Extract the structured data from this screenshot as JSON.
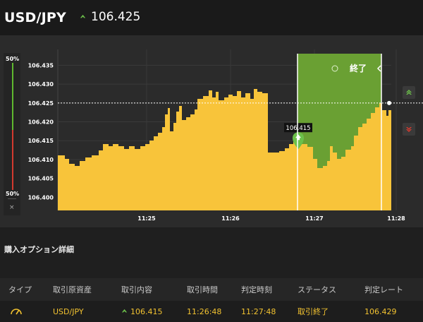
{
  "header": {
    "pair": "USD/JPY",
    "rate": "106.425",
    "rate_direction": "up"
  },
  "gauge": {
    "top_label": "50%",
    "bottom_label": "50%",
    "close_label": "×"
  },
  "chart_data": {
    "type": "area",
    "y_ticks": [
      "106.435",
      "106.430",
      "106.425",
      "106.420",
      "106.415",
      "106.410",
      "106.405",
      "106.400"
    ],
    "x_ticks": [
      "11:25",
      "11:26",
      "11:27",
      "11:28"
    ],
    "current_rate": 106.425,
    "entry_rate": 106.415,
    "entry_label": "106.415",
    "window_label": "終了",
    "colors": {
      "area": "#f8c43a",
      "window": "#6aa033",
      "grid": "#3a3a3a",
      "up": "#6cc04a",
      "down": "#d83a2e"
    }
  },
  "section": {
    "title": "購入オプション詳細"
  },
  "table": {
    "headers": [
      "タイプ",
      "取引原資産",
      "取引内容",
      "取引時間",
      "判定時刻",
      "ステータス",
      "判定レート"
    ],
    "row": {
      "asset": "USD/JPY",
      "direction": "106.415",
      "trade_time": "11:26:48",
      "judge_time": "11:27:48",
      "status": "取引終了",
      "judge_rate": "106.429"
    }
  }
}
